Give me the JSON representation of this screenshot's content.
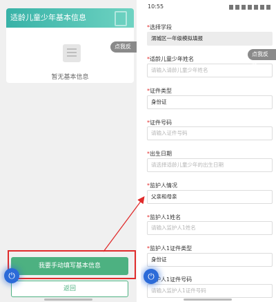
{
  "left": {
    "header_title": "适龄儿童少年基本信息",
    "empty_text": "暂无基本信息",
    "feedback_label": "点我反馈",
    "manual_button": "我要手动填写基本信息",
    "back_button": "返回"
  },
  "right": {
    "status_time": "10:55",
    "feedback_label": "点我反馈",
    "fields": [
      {
        "label": "选择学段",
        "value": "渭城区一年级模拟填报",
        "placeholder": ""
      },
      {
        "label": "适龄儿童少年姓名",
        "value": "",
        "placeholder": "请输入请龄儿童少年姓名"
      },
      {
        "label": "证件类型",
        "value": "身份证",
        "placeholder": ""
      },
      {
        "label": "证件号码",
        "value": "",
        "placeholder": "请输入证件号码"
      },
      {
        "label": "出生日期",
        "value": "",
        "placeholder": "请选择适龄儿童少年的出生日期"
      },
      {
        "label": "监护人情况",
        "value": "父亲和母亲",
        "placeholder": ""
      },
      {
        "label": "监护人1姓名",
        "value": "",
        "placeholder": "请输入监护人1姓名"
      },
      {
        "label": "监护人1证件类型",
        "value": "身份证",
        "placeholder": ""
      },
      {
        "label": "监护人1证件号码",
        "value": "",
        "placeholder": "请输入监护人1证件号码"
      }
    ]
  },
  "colors": {
    "accent_green": "#4db181",
    "header_teal": "#38b2a7",
    "highlight_red": "#e02b2b",
    "power_blue": "#2c6bd8"
  },
  "icons": [
    "empty-document-icon",
    "power-icon",
    "status-icons"
  ]
}
